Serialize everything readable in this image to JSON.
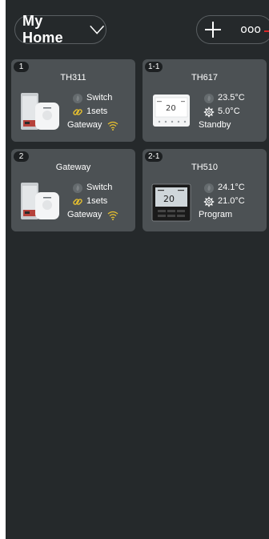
{
  "header": {
    "home_title": "My Home",
    "dots_label": "ooo"
  },
  "cards": [
    {
      "badge": "1",
      "title": "TH311",
      "rows": [
        {
          "icon": "flame-icon",
          "text": "Switch"
        },
        {
          "icon": "link-icon",
          "text": "1sets"
        },
        {
          "icon": "wifi-icon",
          "text": "Gateway"
        }
      ]
    },
    {
      "badge": "1-1",
      "title": "TH617",
      "rows": [
        {
          "icon": "flame-icon",
          "text": "23.5°C"
        },
        {
          "icon": "gear-icon",
          "text": "5.0°C"
        },
        {
          "icon": "",
          "text": "Standby"
        }
      ]
    },
    {
      "badge": "2",
      "title": "Gateway",
      "rows": [
        {
          "icon": "flame-icon",
          "text": "Switch"
        },
        {
          "icon": "link-icon",
          "text": "1sets"
        },
        {
          "icon": "wifi-icon",
          "text": "Gateway"
        }
      ]
    },
    {
      "badge": "2-1",
      "title": "TH510",
      "rows": [
        {
          "icon": "flame-icon",
          "text": "24.1°C"
        },
        {
          "icon": "gear-icon",
          "text": "21.0°C"
        },
        {
          "icon": "",
          "text": "Program"
        }
      ]
    }
  ],
  "colors": {
    "background": "#25292b",
    "card": "#4c5154",
    "link_accent": "#e8c12f",
    "wifi_accent": "#e8c12f",
    "alert_line": "#d62828"
  }
}
